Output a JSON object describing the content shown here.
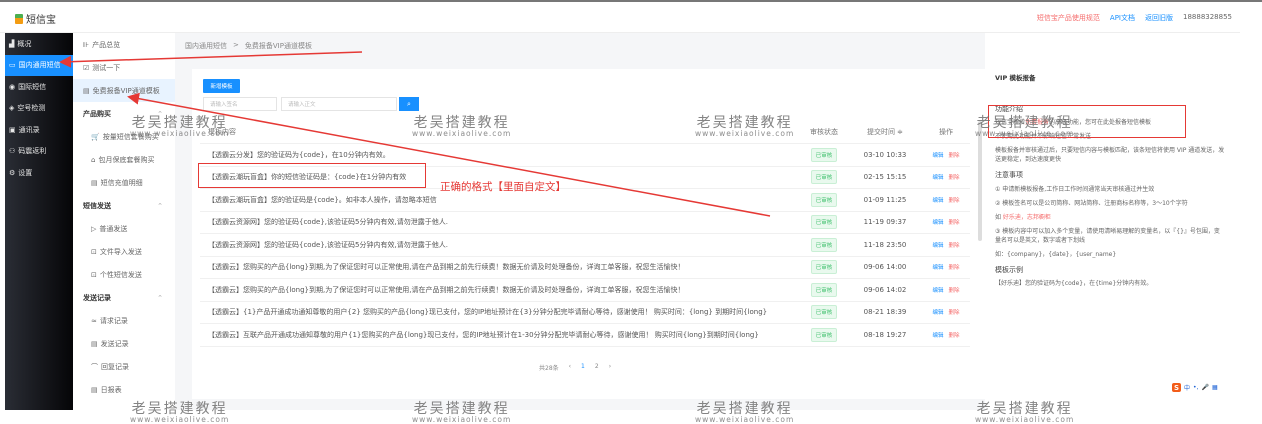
{
  "app": {
    "name": "短信宝"
  },
  "header": {
    "links": [
      {
        "label": "短信宝产品使用规范",
        "color": "#f56c6c"
      },
      {
        "label": "API文档",
        "color": "#1890ff"
      },
      {
        "label": "返回旧版",
        "color": "#1890ff"
      },
      {
        "label": "18888328855",
        "color": "#666"
      }
    ]
  },
  "sidebar": {
    "items": [
      {
        "icon": "▟",
        "label": "概况"
      },
      {
        "icon": "▭",
        "label": "国内通用短信"
      },
      {
        "icon": "◉",
        "label": "国际短信"
      },
      {
        "icon": "◈",
        "label": "空号检测"
      },
      {
        "icon": "▣",
        "label": "通讯录"
      },
      {
        "icon": "⚇",
        "label": "码震返利"
      },
      {
        "icon": "⚙",
        "label": "设置"
      }
    ]
  },
  "submenu": {
    "top": [
      {
        "icon": "⊪",
        "label": "产品总览"
      },
      {
        "icon": "☑",
        "label": "测试一下"
      },
      {
        "icon": "▤",
        "label": "免费报备VIP通道模板"
      }
    ],
    "groups": [
      {
        "title": "产品购买",
        "items": [
          {
            "icon": "🛒",
            "label": "按量短信套餐购买"
          },
          {
            "icon": "⌂",
            "label": "包月保底套餐购买"
          },
          {
            "icon": "▤",
            "label": "短信充值明细"
          }
        ]
      },
      {
        "title": "短信发送",
        "items": [
          {
            "icon": "▷",
            "label": "普通发送"
          },
          {
            "icon": "⊡",
            "label": "文件导入发送"
          },
          {
            "icon": "⊡",
            "label": "个性短信发送"
          }
        ]
      },
      {
        "title": "发送记录",
        "items": [
          {
            "icon": "≈",
            "label": "请求记录"
          },
          {
            "icon": "▤",
            "label": "发送记录"
          },
          {
            "icon": "⌒",
            "label": "回复记录"
          },
          {
            "icon": "▤",
            "label": "日报表"
          }
        ]
      }
    ]
  },
  "breadcrumb": [
    "国内通用短信",
    ">",
    "免费报备VIP通道模板"
  ],
  "toolbar": {
    "new_label": "新增模板",
    "sign_placeholder": "请输入签名",
    "content_placeholder": "请输入正文",
    "search_icon": "⌕"
  },
  "table": {
    "headers": [
      "模板内容",
      "审核状态",
      "提交时间 ≑",
      "操作"
    ],
    "rows": [
      {
        "content": "【透霸云分发】您的验证码为{code}，在10分钟内有效。",
        "status": "已审核",
        "time": "03-10 10:33"
      },
      {
        "content": "【透霸云潮玩盲盒】你的短信验证码是：{code}在1分钟内有效",
        "status": "已审核",
        "time": "02-15 15:15"
      },
      {
        "content": "【透霸云潮玩盲盒】您的验证码是{code}。如非本人操作，请忽略本短信",
        "status": "已审核",
        "time": "01-09 11:25"
      },
      {
        "content": "【透霸云资源网】您的验证码{code},该验证码5分钟内有效,请勿泄露于他人.",
        "status": "已审核",
        "time": "11-19 09:37"
      },
      {
        "content": "【透霸云资源网】您的验证码{code},该验证码5分钟内有效,请勿泄露于他人.",
        "status": "已审核",
        "time": "11-18 23:50"
      },
      {
        "content": "【透霸云】您购买的产品{long}到期,为了保证您时可以正常使用,请在产品到期之前先行续费！数据无价请及时处理备份，详询工单客服，祝您生活愉快！",
        "status": "已审核",
        "time": "09-06 14:00"
      },
      {
        "content": "【透霸云】您购买的产品{long}到期,为了保证您时可以正常使用,请在产品到期之前先行续费！数据无价请及时处理备份，详询工单客服，祝您生活愉快！",
        "status": "已审核",
        "time": "09-06 14:02"
      },
      {
        "content": "【透霸云】{1}产品开通成功通知尊敬的用户{2} 您购买的产品{long}现已支付，您的IP地址预计在{3}分钟分配完毕请耐心等待，感谢使用！ 购买时间：{long} 到期时间{long}",
        "status": "已审核",
        "time": "08-21 18:39"
      },
      {
        "content": "【透霸云】互联产品开通成功通知尊敬的用户{1}您购买的产品{long}现已支付，您的IP地址预计在1-30分钟分配完毕请耐心等待，感谢使用！ 购买时间{long}到期时间{long}",
        "status": "已审核",
        "time": "08-18 19:27"
      }
    ],
    "edit_label": "编辑",
    "delete_label": "删除"
  },
  "pagination": {
    "total": "共28条",
    "prev": "‹",
    "pages": [
      "1",
      "2"
    ],
    "next": "›",
    "current": "1"
  },
  "panel": {
    "title": "VIP 模板报备",
    "intro_title": "功能介绍",
    "intro_pre": "短信宝新增",
    "intro_red": "免费报备",
    "intro_post": "的高级功能，您可在此处报备短信模板",
    "p2": "不使用此功能并不影响短信正常发送",
    "p3": "模板报备并审核通过后，只要短信内容与模板匹配，该条短信将使用 VIP 通道发送，发送更稳定，到达速度更快",
    "notes_title": "注意事项",
    "n1": "① 申请新模板报备,工作日工作时间通常当天审核通过并生效",
    "n2": "② 模板签名可以是公司简称、网站简称、注册商标名称等，3～10个字符",
    "n2_ex_pre": "如 ",
    "n2_ex": "好乐迪，志邦橱柜",
    "n3": "③ 模板内容中可以加入多个变量，请使用清晰易理解的变量名，以『{}』号包围，变量名可以是英文，数字或者下划线",
    "n3_ex": "如：{company}，{date}，{user_name}",
    "example_title": "模板示例",
    "example": "【好乐迪】您的验证码为{code}，在{time}分钟内有效。"
  },
  "annotation": {
    "text": "正确的格式【里面自定文】",
    "color": "#e53935"
  },
  "watermark": {
    "title": "老吴搭建教程",
    "url": "www.weixiaolive.com"
  },
  "ime": {
    "logo": "S",
    "items": [
      "中",
      "•,",
      "🎤",
      "▦"
    ]
  }
}
